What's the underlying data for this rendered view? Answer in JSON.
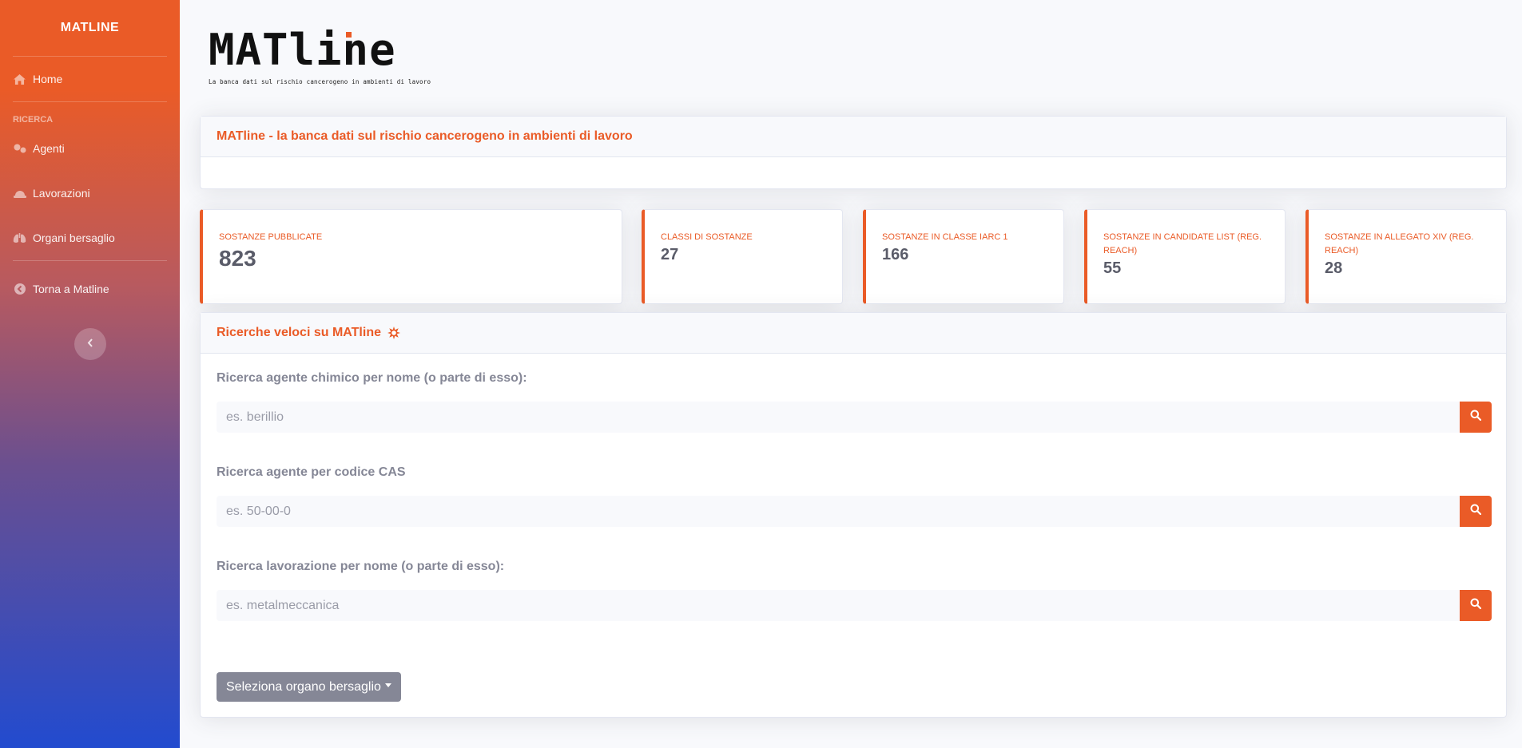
{
  "sidebar": {
    "brand": "MATLINE",
    "home": "Home",
    "heading": "RICERCA",
    "items": [
      {
        "label": "Agenti",
        "icon": "atoms-icon"
      },
      {
        "label": "Lavorazioni",
        "icon": "hard-hat-icon"
      },
      {
        "label": "Organi bersaglio",
        "icon": "lungs-icon"
      }
    ],
    "back": "Torna a Matline"
  },
  "logo": {
    "title": "MATline",
    "subtitle": "La banca dati sul rischio cancerogeno in ambienti di lavoro"
  },
  "intro_card": {
    "title": "MATline - la banca dati sul rischio cancerogeno in ambienti di lavoro"
  },
  "stats": [
    {
      "label": "SOSTANZE PUBBLICATE",
      "value": "823"
    },
    {
      "label": "CLASSI DI SOSTANZE",
      "value": "27"
    },
    {
      "label": "SOSTANZE IN CLASSE IARC 1",
      "value": "166"
    },
    {
      "label": "SOSTANZE IN CANDIDATE LIST (REG. REACH)",
      "value": "55"
    },
    {
      "label": "SOSTANZE IN ALLEGATO XIV (REG. REACH)",
      "value": "28"
    }
  ],
  "quick_search": {
    "title": "Ricerche veloci su MATline",
    "fields": [
      {
        "label": "Ricerca agente chimico per nome (o parte di esso):",
        "placeholder": "es. berillio",
        "value": ""
      },
      {
        "label": "Ricerca agente per codice CAS",
        "placeholder": "es. 50-00-0",
        "value": ""
      },
      {
        "label": "Ricerca lavorazione per nome (o parte di esso):",
        "placeholder": "es. metalmeccanica",
        "value": ""
      }
    ],
    "dropdown_label": "Seleziona organo bersaglio"
  },
  "colors": {
    "accent": "#ea5b27",
    "secondary": "#858796",
    "sidebar_top": "#ea5b27",
    "sidebar_bottom": "#224bcf"
  }
}
